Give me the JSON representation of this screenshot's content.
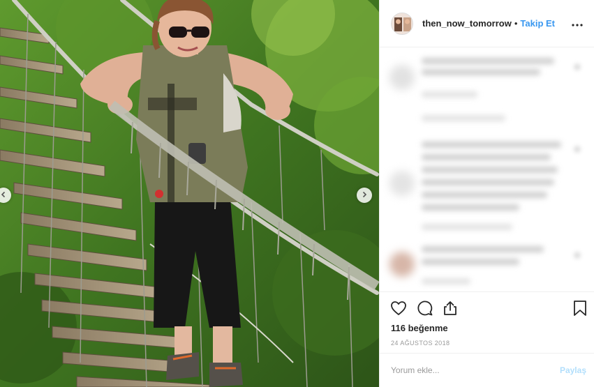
{
  "post": {
    "username": "then_now_tomorrow",
    "separator": "•",
    "follow_label": "Takip Et",
    "likes_text": "116 beğenme",
    "date_text": "24 AĞUSTOS 2018"
  },
  "comment_form": {
    "placeholder": "Yorum ekle...",
    "post_label": "Paylaş"
  },
  "icons": {
    "more": "more-options-icon",
    "like": "heart-icon",
    "comment": "comment-icon",
    "share": "share-icon",
    "save": "bookmark-icon",
    "prev": "chevron-left-icon",
    "next": "chevron-right-icon"
  },
  "colors": {
    "follow": "#3897f0",
    "post_disabled": "#b2dffc",
    "meta_gray": "#999999",
    "border": "#efefef"
  }
}
